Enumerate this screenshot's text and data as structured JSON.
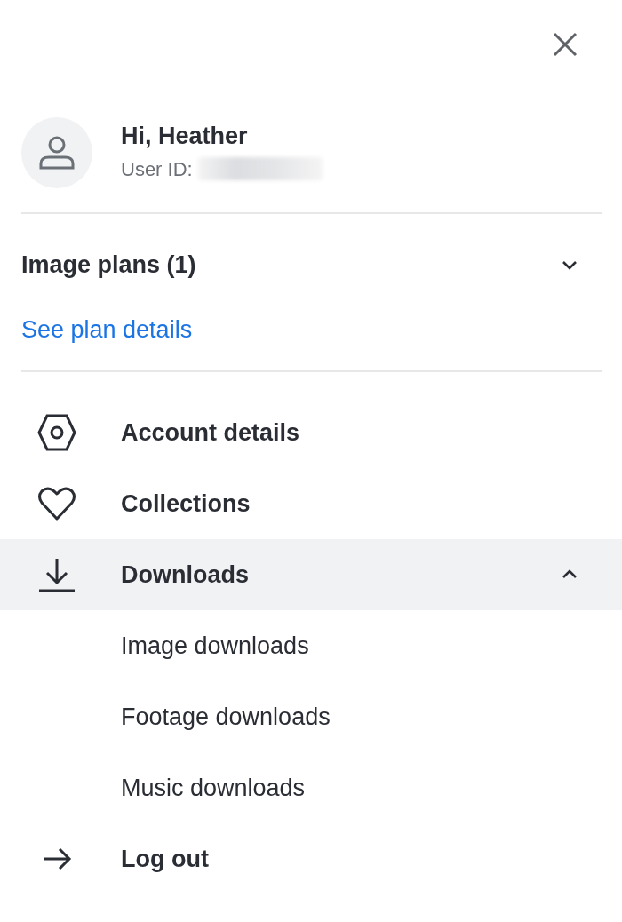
{
  "user": {
    "greeting": "Hi, Heather",
    "id_label": "User ID:"
  },
  "plans": {
    "title": "Image plans (1)",
    "expanded": false,
    "link": "See plan details"
  },
  "menu": [
    {
      "label": "Account details",
      "highlighted": false
    },
    {
      "label": "Collections",
      "highlighted": false
    },
    {
      "label": "Downloads",
      "expanded": true,
      "highlighted": true,
      "children": [
        {
          "label": "Image downloads"
        },
        {
          "label": "Footage downloads"
        },
        {
          "label": "Music downloads"
        }
      ]
    },
    {
      "label": "Log out",
      "highlighted": false
    }
  ]
}
